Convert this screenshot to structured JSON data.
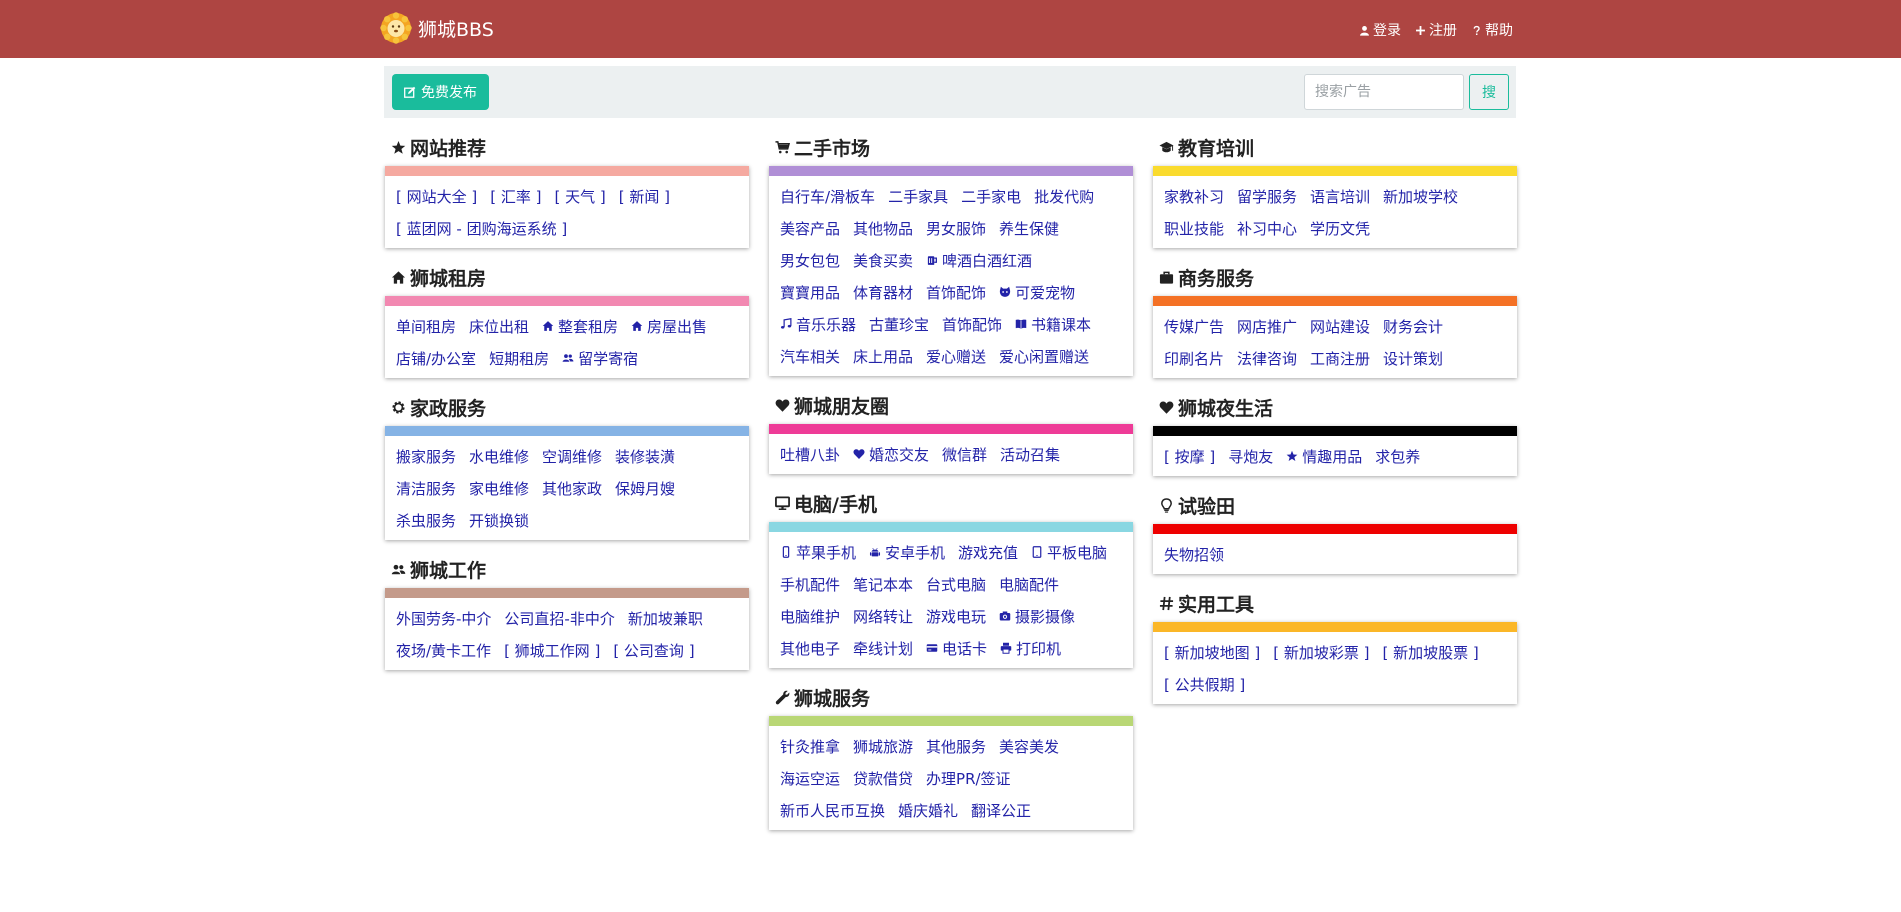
{
  "brand": {
    "name": "狮城BBS"
  },
  "nav": [
    {
      "name": "nav-login",
      "icon": "user-icon",
      "label": "登录"
    },
    {
      "name": "nav-register",
      "icon": "plus-icon",
      "label": "注册"
    },
    {
      "name": "nav-help",
      "icon": "question-icon",
      "label": "帮助"
    }
  ],
  "toolbar": {
    "post_label": "免费发布",
    "search_placeholder": "搜索广告",
    "search_button": "搜"
  },
  "columns": [
    [
      {
        "title": "网站推荐",
        "icon": "star-icon",
        "color": "#f5a9a0",
        "rows": [
          [
            {
              "t": "[ 网站大全 ]"
            },
            {
              "t": "[ 汇率 ]"
            },
            {
              "t": "[ 天气 ]"
            },
            {
              "t": "[ 新闻 ]"
            }
          ],
          [
            {
              "t": "[ 蓝团网 - 团购海运系统 ]"
            }
          ]
        ]
      },
      {
        "title": "狮城租房",
        "icon": "home-icon",
        "color": "#f288b1",
        "rows": [
          [
            {
              "t": "单间租房"
            },
            {
              "t": "床位出租"
            },
            {
              "t": "整套租房",
              "i": "home-icon"
            },
            {
              "t": "房屋出售",
              "i": "home-icon"
            }
          ],
          [
            {
              "t": "店铺/办公室"
            },
            {
              "t": "短期租房"
            },
            {
              "t": "留学寄宿",
              "i": "users-icon"
            }
          ]
        ]
      },
      {
        "title": "家政服务",
        "icon": "gear-icon",
        "color": "#85b3e5",
        "rows": [
          [
            {
              "t": "搬家服务"
            },
            {
              "t": "水电维修"
            },
            {
              "t": "空调维修"
            },
            {
              "t": "装修装潢"
            }
          ],
          [
            {
              "t": "清洁服务"
            },
            {
              "t": "家电维修"
            },
            {
              "t": "其他家政"
            },
            {
              "t": "保姆月嫂"
            }
          ],
          [
            {
              "t": "杀虫服务"
            },
            {
              "t": "开锁换锁"
            }
          ]
        ]
      },
      {
        "title": "狮城工作",
        "icon": "users-icon",
        "color": "#c49a8a",
        "rows": [
          [
            {
              "t": "外国劳务-中介"
            },
            {
              "t": "公司直招-非中介"
            },
            {
              "t": "新加坡兼职"
            }
          ],
          [
            {
              "t": "夜场/黄卡工作"
            },
            {
              "t": "[ 狮城工作网 ]"
            },
            {
              "t": "[ 公司查询 ]"
            }
          ]
        ]
      }
    ],
    [
      {
        "title": "二手市场",
        "icon": "cart-icon",
        "color": "#b08fd6",
        "rows": [
          [
            {
              "t": "自行车/滑板车"
            },
            {
              "t": "二手家具"
            },
            {
              "t": "二手家电"
            },
            {
              "t": "批发代购"
            }
          ],
          [
            {
              "t": "美容产品"
            },
            {
              "t": "其他物品"
            },
            {
              "t": "男女服饰"
            },
            {
              "t": "养生保健"
            }
          ],
          [
            {
              "t": "男女包包"
            },
            {
              "t": "美食买卖"
            },
            {
              "t": "啤酒白酒红酒",
              "i": "beer-icon"
            }
          ],
          [
            {
              "t": "寶寶用品"
            },
            {
              "t": "体育器材"
            },
            {
              "t": "首饰配饰"
            },
            {
              "t": "可爱宠物",
              "i": "pet-icon"
            }
          ],
          [
            {
              "t": "音乐乐器",
              "i": "music-icon"
            },
            {
              "t": "古董珍宝"
            },
            {
              "t": "首饰配饰"
            },
            {
              "t": "书籍课本",
              "i": "book-icon"
            }
          ],
          [
            {
              "t": "汽车相关"
            },
            {
              "t": "床上用品"
            },
            {
              "t": "爱心赠送"
            },
            {
              "t": "爱心闲置赠送"
            }
          ]
        ]
      },
      {
        "title": "狮城朋友圈",
        "icon": "heart-icon",
        "color": "#ee3b97",
        "rows": [
          [
            {
              "t": "吐槽八卦"
            },
            {
              "t": "婚恋交友",
              "i": "heart-icon"
            },
            {
              "t": "微信群"
            },
            {
              "t": "活动召集"
            }
          ]
        ]
      },
      {
        "title": "电脑/手机",
        "icon": "monitor-icon",
        "color": "#8ad7e2",
        "rows": [
          [
            {
              "t": "苹果手机",
              "i": "phone-icon"
            },
            {
              "t": "安卓手机",
              "i": "android-icon"
            },
            {
              "t": "游戏充值"
            },
            {
              "t": "平板电脑",
              "i": "tablet-icon"
            }
          ],
          [
            {
              "t": "手机配件"
            },
            {
              "t": "笔记本本"
            },
            {
              "t": "台式电脑"
            },
            {
              "t": "电脑配件"
            }
          ],
          [
            {
              "t": "电脑维护"
            },
            {
              "t": "网络转让"
            },
            {
              "t": "游戏电玩"
            },
            {
              "t": "摄影摄像",
              "i": "camera-icon"
            }
          ],
          [
            {
              "t": "其他电子"
            },
            {
              "t": "牵线计划"
            },
            {
              "t": "电话卡",
              "i": "card-icon"
            },
            {
              "t": "打印机",
              "i": "printer-icon"
            }
          ]
        ]
      },
      {
        "title": "狮城服务",
        "icon": "wrench-icon",
        "color": "#b9d775",
        "rows": [
          [
            {
              "t": "针灸推拿"
            },
            {
              "t": "狮城旅游"
            },
            {
              "t": "其他服务"
            },
            {
              "t": "美容美发"
            }
          ],
          [
            {
              "t": "海运空运"
            },
            {
              "t": "贷款借贷"
            },
            {
              "t": "办理PR/签证"
            }
          ],
          [
            {
              "t": "新币人民币互换"
            },
            {
              "t": "婚庆婚礼"
            },
            {
              "t": "翻译公正"
            }
          ]
        ]
      }
    ],
    [
      {
        "title": "教育培训",
        "icon": "graduation-icon",
        "color": "#fadb2e",
        "rows": [
          [
            {
              "t": "家教补习"
            },
            {
              "t": "留学服务"
            },
            {
              "t": "语言培训"
            },
            {
              "t": "新加坡学校"
            }
          ],
          [
            {
              "t": "职业技能"
            },
            {
              "t": "补习中心"
            },
            {
              "t": "学历文凭"
            }
          ]
        ]
      },
      {
        "title": "商务服务",
        "icon": "briefcase-icon",
        "color": "#f47125",
        "rows": [
          [
            {
              "t": "传媒广告"
            },
            {
              "t": "网店推广"
            },
            {
              "t": "网站建设"
            },
            {
              "t": "财务会计"
            }
          ],
          [
            {
              "t": "印刷名片"
            },
            {
              "t": "法律咨询"
            },
            {
              "t": "工商注册"
            },
            {
              "t": "设计策划"
            }
          ]
        ]
      },
      {
        "title": "狮城夜生活",
        "icon": "heart-icon",
        "color": "#000000",
        "rows": [
          [
            {
              "t": "[ 按摩 ]"
            },
            {
              "t": "寻炮友"
            },
            {
              "t": "情趣用品",
              "i": "star-icon"
            },
            {
              "t": "求包养"
            }
          ]
        ]
      },
      {
        "title": "试验田",
        "icon": "bulb-icon",
        "color": "#ee0000",
        "rows": [
          [
            {
              "t": "失物招领"
            }
          ]
        ]
      },
      {
        "title": "实用工具",
        "icon": "hash-icon",
        "color": "#fbb728",
        "rows": [
          [
            {
              "t": "[ 新加坡地图 ]"
            },
            {
              "t": "[ 新加坡彩票 ]"
            },
            {
              "t": "[ 新加坡股票 ]"
            }
          ],
          [
            {
              "t": "[ 公共假期 ]"
            }
          ]
        ]
      }
    ]
  ]
}
